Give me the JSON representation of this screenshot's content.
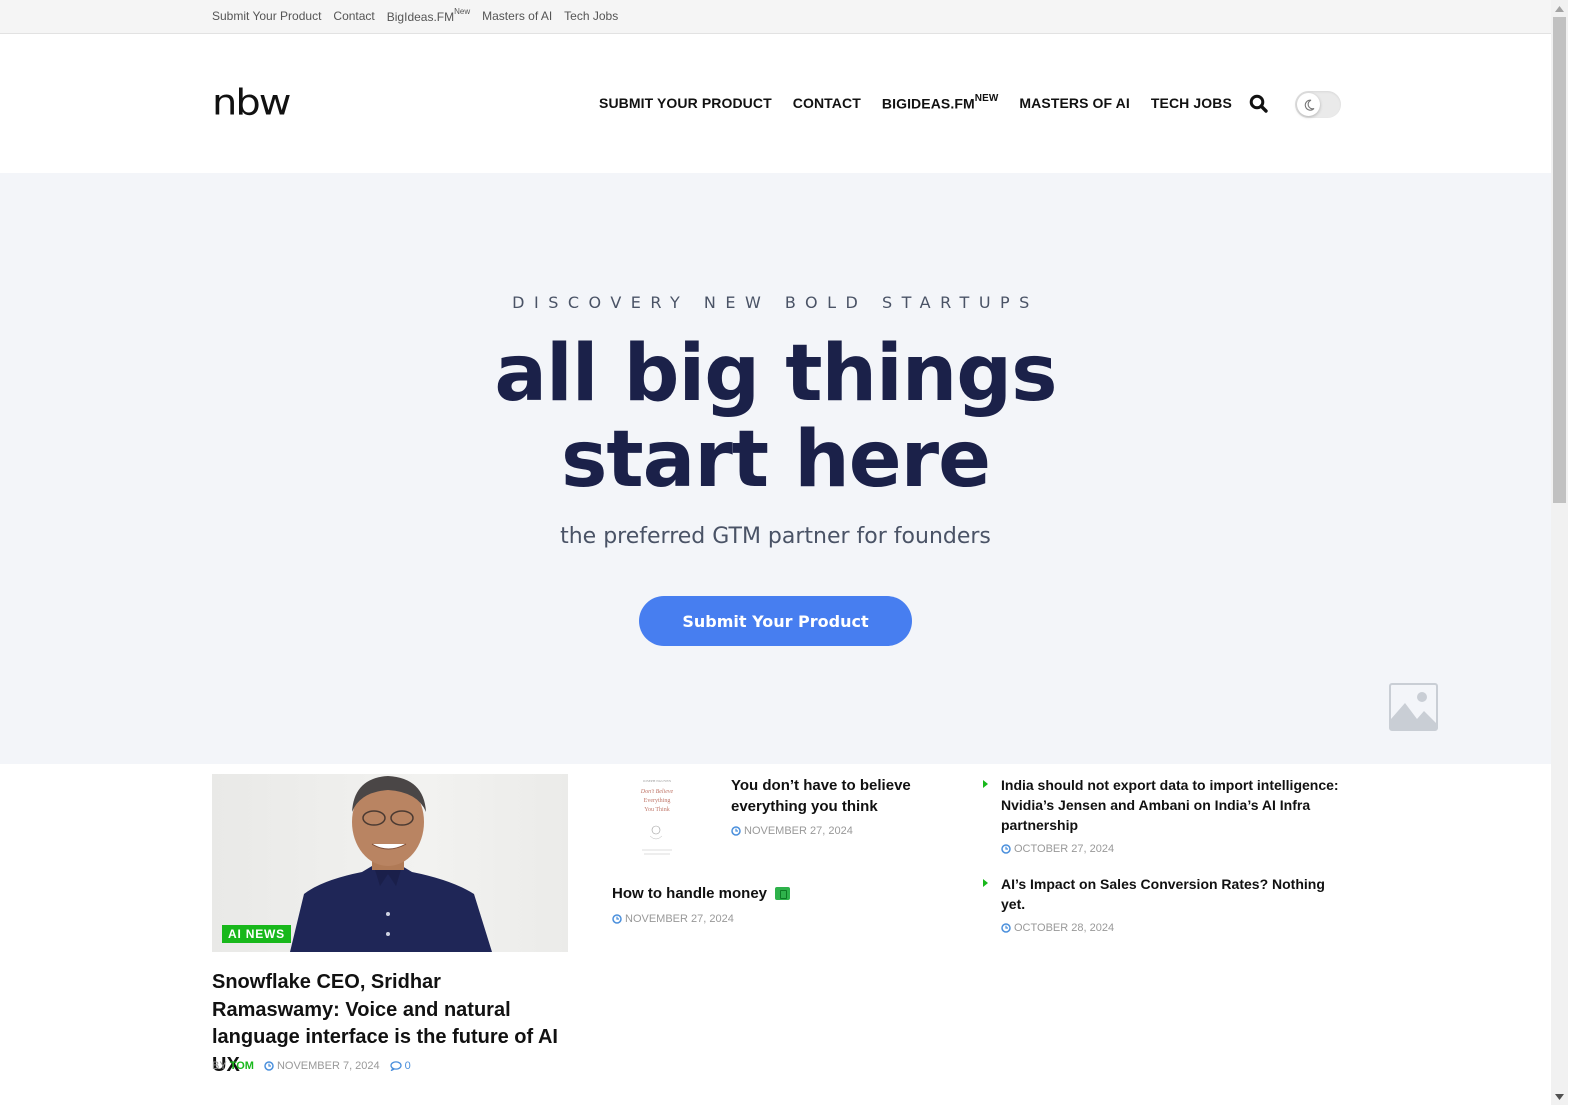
{
  "topbar": {
    "links": [
      {
        "label": "Submit Your Product"
      },
      {
        "label": "Contact"
      },
      {
        "label": "BigIdeas.FM",
        "sup": "New"
      },
      {
        "label": "Masters of AI"
      },
      {
        "label": "Tech Jobs"
      }
    ]
  },
  "header": {
    "logo": "nbw",
    "nav": [
      {
        "label": "SUBMIT YOUR PRODUCT"
      },
      {
        "label": "CONTACT"
      },
      {
        "label": "BIGIDEAS.FM",
        "sup": "NEW"
      },
      {
        "label": "MASTERS OF AI"
      },
      {
        "label": "TECH JOBS"
      }
    ],
    "search_icon": "search-icon",
    "theme_toggle_icon": "moon-icon"
  },
  "hero": {
    "eyebrow": "DISCOVERY NEW BOLD STARTUPS",
    "headline_line1": "all big things",
    "headline_line2": "start here",
    "subline": "the preferred GTM partner for founders",
    "cta_label": "Submit Your Product",
    "accent_color": "#477ef0",
    "headline_color": "#1b2149"
  },
  "articles": {
    "featured": {
      "category": "AI NEWS",
      "title": "Snowflake CEO, Sridhar Ramaswamy: Voice and natural language interface is the future of AI UX",
      "by": "BY",
      "author": "TOM",
      "date": "NOVEMBER 7, 2024",
      "comments": "0"
    },
    "middle": [
      {
        "title": "You don’t have to believe everything you think",
        "date": "NOVEMBER 27, 2024",
        "thumb": {
          "author": "JOSEPH NGUYEN",
          "line1": "Don't Believe",
          "line2": "Everything",
          "line3": "You Think"
        }
      },
      {
        "title": "How to handle money",
        "emoji": "money-icon",
        "date": "NOVEMBER 27, 2024"
      }
    ],
    "right": [
      {
        "title": "India should not export data to import intelligence: Nvidia’s Jensen and Ambani on India’s AI Infra partnership",
        "date": "OCTOBER 27, 2024"
      },
      {
        "title": "AI’s Impact on Sales Conversion Rates? Nothing yet.",
        "date": "OCTOBER 28, 2024"
      }
    ],
    "category_color": "#18b81b"
  }
}
